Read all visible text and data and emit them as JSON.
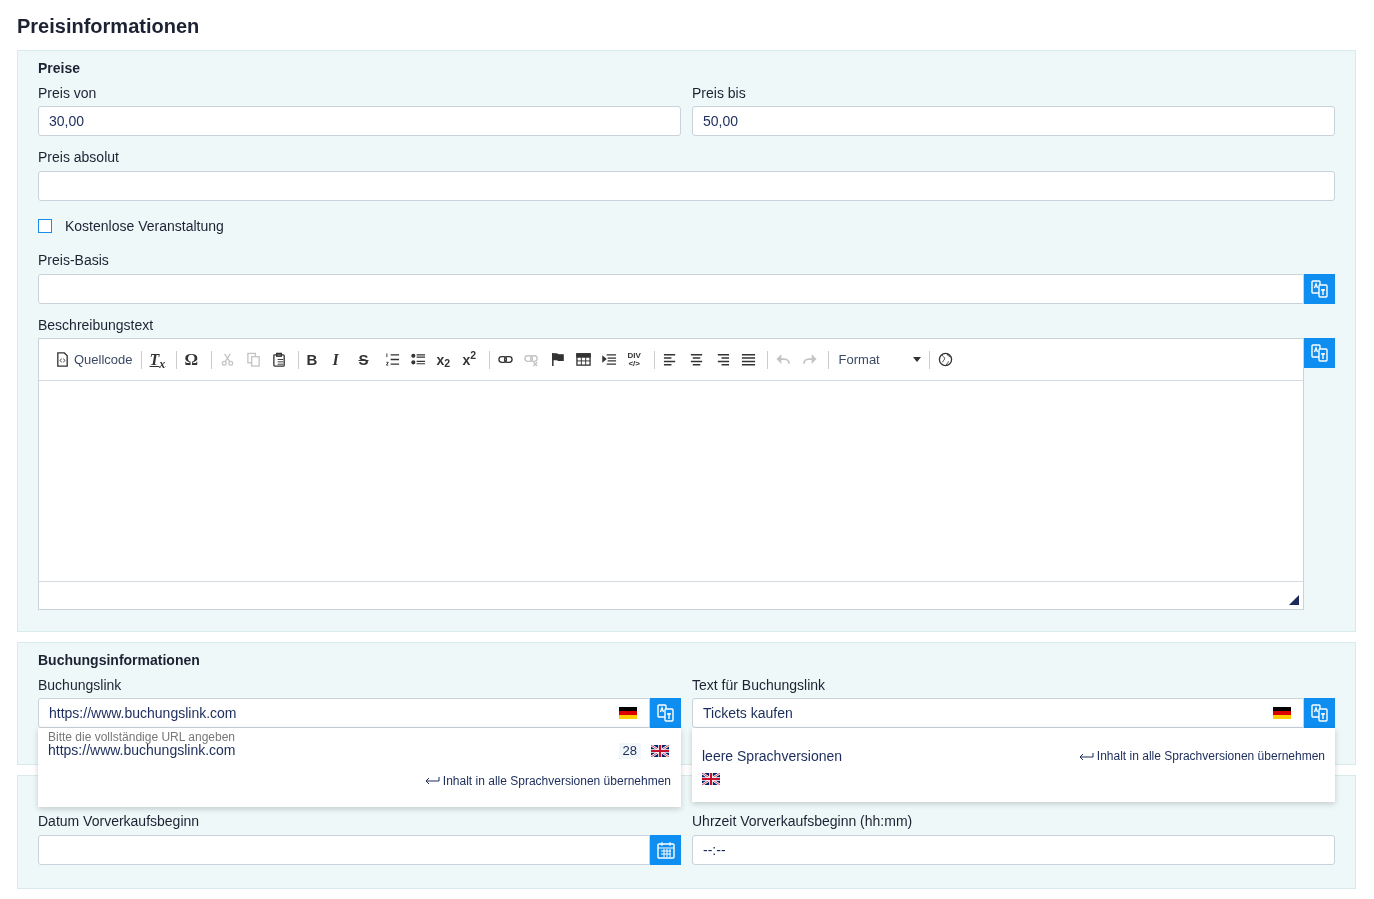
{
  "page_title": "Preisinformationen",
  "price_section": {
    "heading": "Preise",
    "price_from": {
      "label": "Preis von",
      "value": "30,00"
    },
    "price_to": {
      "label": "Preis bis",
      "value": "50,00"
    },
    "price_absolute": {
      "label": "Preis absolut"
    },
    "free_event": {
      "label": "Kostenlose Veranstaltung",
      "checked": false
    },
    "price_basis": {
      "label": "Preis-Basis"
    },
    "description": {
      "label": "Beschreibungstext",
      "toolbar": [
        {
          "items": [
            {
              "kind": "source",
              "text": "Quellcode",
              "disabled": false
            }
          ]
        },
        {
          "items": [
            {
              "kind": "removeformat",
              "text": "T$_{x}$",
              "disabled": false
            }
          ]
        },
        {
          "items": [
            {
              "kind": "specialchar",
              "text": "Ω",
              "disabled": false
            }
          ]
        },
        {
          "items": [
            {
              "kind": "cut",
              "disabled": true
            },
            {
              "kind": "copy",
              "disabled": true
            },
            {
              "kind": "paste",
              "disabled": false
            }
          ]
        },
        {
          "items": [
            {
              "kind": "bold",
              "text": "B",
              "disabled": false
            },
            {
              "kind": "italic",
              "text": "I",
              "disabled": false
            },
            {
              "kind": "strike",
              "text": "S",
              "disabled": false
            },
            {
              "kind": "numlist",
              "disabled": false
            },
            {
              "kind": "bulletlist",
              "disabled": false
            },
            {
              "kind": "subscript",
              "text": "x$_{2}$",
              "disabled": false
            },
            {
              "kind": "superscript",
              "text": "x$^{2}$",
              "disabled": false
            }
          ]
        },
        {
          "items": [
            {
              "kind": "link",
              "disabled": false
            },
            {
              "kind": "unlink",
              "disabled": true
            },
            {
              "kind": "anchor",
              "disabled": false
            },
            {
              "kind": "table",
              "disabled": false
            },
            {
              "kind": "blockquote",
              "disabled": false
            },
            {
              "kind": "div",
              "text": "DIV",
              "code": "</>",
              "disabled": false
            }
          ]
        },
        {
          "items": [
            {
              "kind": "alignleft",
              "disabled": false
            },
            {
              "kind": "aligncenter",
              "disabled": false
            },
            {
              "kind": "alignright",
              "disabled": false
            },
            {
              "kind": "justify",
              "disabled": false
            }
          ]
        },
        {
          "items": [
            {
              "kind": "undo",
              "disabled": true
            },
            {
              "kind": "redo",
              "disabled": true
            }
          ]
        },
        {
          "items": [
            {
              "kind": "format",
              "text": "Format",
              "disabled": false
            }
          ]
        },
        {
          "items": [
            {
              "kind": "language",
              "disabled": false
            }
          ]
        }
      ]
    }
  },
  "booking_section": {
    "heading": "Buchungsinformationen",
    "booking_link": {
      "label": "Buchungslink",
      "value": "https://www.buchungslink.com",
      "popup": {
        "hint": "Bitte die vollständige URL angeben",
        "value": "https://www.buchungslink.com",
        "count": "28",
        "action": "Inhalt in alle Sprachversionen übernehmen"
      }
    },
    "link_text": {
      "label": "Text für Buchungslink",
      "value": "Tickets kaufen",
      "popup": {
        "message": "leere Sprachversionen",
        "action": "Inhalt in alle Sprachversionen übernehmen"
      }
    }
  },
  "presale_section": {
    "date": {
      "label": "Datum Vorverkaufsbeginn"
    },
    "time": {
      "label": "Uhrzeit Vorverkaufsbeginn (hh:mm)",
      "placeholder": "--:--"
    }
  }
}
